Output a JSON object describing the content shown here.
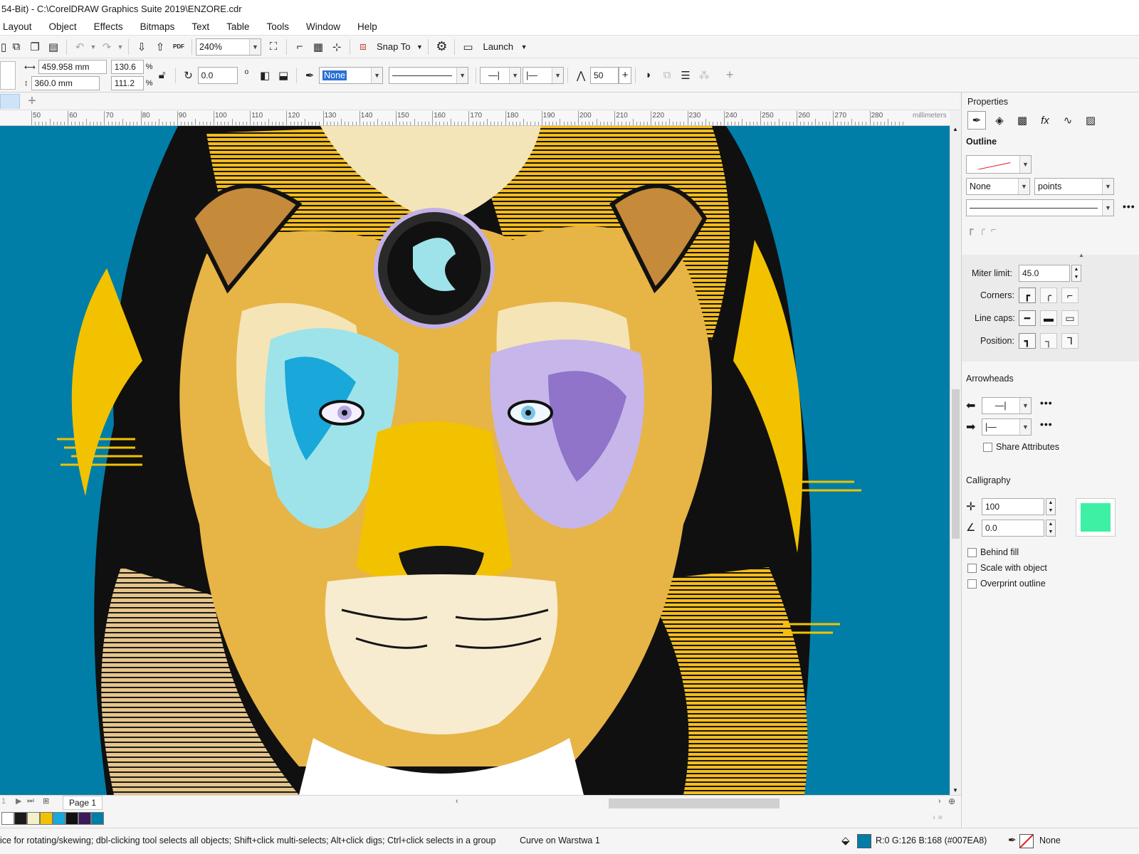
{
  "window": {
    "title": "54-Bit) - C:\\CorelDRAW Graphics Suite 2019\\ENZORE.cdr"
  },
  "menu": [
    "Layout",
    "Object",
    "Effects",
    "Bitmaps",
    "Text",
    "Table",
    "Tools",
    "Window",
    "Help"
  ],
  "toolbar": {
    "zoom": "240%",
    "snap_to": "Snap To",
    "launch": "Launch",
    "pdf": "PDF"
  },
  "propbar": {
    "width": "459.958 mm",
    "height": "360.0 mm",
    "scale_x": "130.6",
    "scale_y": "111.2",
    "pct_x": "%",
    "pct_y": "%",
    "rotation": "0.0",
    "degree": "o",
    "outline_width": "None",
    "smoothing": "50"
  },
  "ruler": {
    "unit": "millimeters",
    "labels": [
      "50",
      "60",
      "70",
      "80",
      "90",
      "100",
      "110",
      "120",
      "130",
      "140",
      "150",
      "160",
      "170",
      "180",
      "190",
      "200",
      "210",
      "220",
      "230",
      "240",
      "250",
      "260",
      "270",
      "280"
    ]
  },
  "page": {
    "tab": "Page 1",
    "page_num": "1"
  },
  "palette": {
    "colors": [
      "#ffffff",
      "#1a1a1a",
      "#f4f0c8",
      "#f2c200",
      "#1aa7d9",
      "#101010",
      "#3a1a5a",
      "#007EA8"
    ]
  },
  "status": {
    "hint": "ice for rotating/skewing; dbl-clicking tool selects all objects; Shift+click multi-selects; Alt+click digs; Ctrl+click selects in a group",
    "object": "Curve on Warstwa 1",
    "fill_readout": "R:0 G:126 B:168 (#007EA8)",
    "fill_color": "#007EA8",
    "outline": "None"
  },
  "properties": {
    "title": "Properties",
    "outline_header": "Outline",
    "width_value": "None",
    "units": "points",
    "miter_label": "Miter limit:",
    "miter_value": "45.0",
    "corners_label": "Corners:",
    "linecaps_label": "Line caps:",
    "position_label": "Position:",
    "arrowheads_header": "Arrowheads",
    "share_attributes": "Share Attributes",
    "calligraphy_header": "Calligraphy",
    "stretch_value": "100",
    "angle_value": "0.0",
    "calligraphy_color": "#3ef0a4",
    "behind_fill": "Behind fill",
    "scale_with_object": "Scale with object",
    "overprint_outline": "Overprint outline"
  }
}
